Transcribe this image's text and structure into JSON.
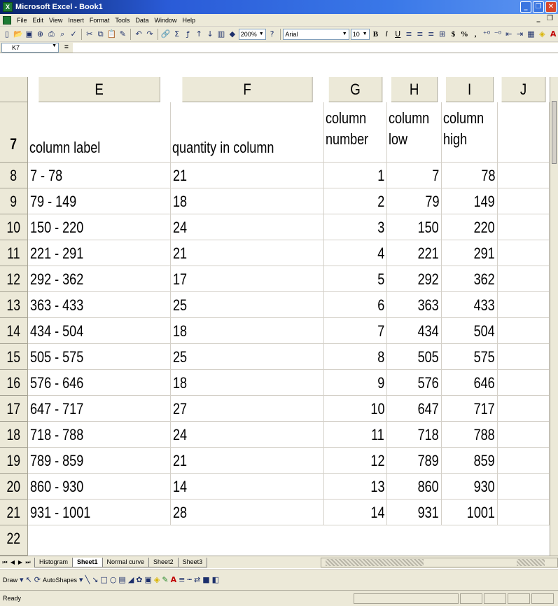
{
  "window": {
    "title": "Microsoft Excel - Book1"
  },
  "menu": [
    "File",
    "Edit",
    "View",
    "Insert",
    "Format",
    "Tools",
    "Data",
    "Window",
    "Help"
  ],
  "toolbar": {
    "zoom": "200%",
    "font": "Arial",
    "size": "10",
    "currency": "$",
    "percent": "%",
    "comma": ","
  },
  "formula_bar": {
    "name_box": "K7",
    "eq": "="
  },
  "columns": [
    "E",
    "F",
    "G",
    "H",
    "I",
    "J"
  ],
  "header_row": {
    "row": "7",
    "E": "column label",
    "F": "quantity in column",
    "G": [
      "column",
      "number"
    ],
    "H": [
      "column",
      "low"
    ],
    "I": [
      "column",
      "high"
    ]
  },
  "rows": [
    {
      "row": "8",
      "label": "7 - 78",
      "qty": "21",
      "num": "1",
      "low": "7",
      "high": "78"
    },
    {
      "row": "9",
      "label": "79 - 149",
      "qty": "18",
      "num": "2",
      "low": "79",
      "high": "149"
    },
    {
      "row": "10",
      "label": "150 - 220",
      "qty": "24",
      "num": "3",
      "low": "150",
      "high": "220"
    },
    {
      "row": "11",
      "label": "221 - 291",
      "qty": "21",
      "num": "4",
      "low": "221",
      "high": "291"
    },
    {
      "row": "12",
      "label": "292 - 362",
      "qty": "17",
      "num": "5",
      "low": "292",
      "high": "362"
    },
    {
      "row": "13",
      "label": "363 - 433",
      "qty": "25",
      "num": "6",
      "low": "363",
      "high": "433"
    },
    {
      "row": "14",
      "label": "434 - 504",
      "qty": "18",
      "num": "7",
      "low": "434",
      "high": "504"
    },
    {
      "row": "15",
      "label": "505 - 575",
      "qty": "25",
      "num": "8",
      "low": "505",
      "high": "575"
    },
    {
      "row": "16",
      "label": "576 - 646",
      "qty": "18",
      "num": "9",
      "low": "576",
      "high": "646"
    },
    {
      "row": "17",
      "label": "647 - 717",
      "qty": "27",
      "num": "10",
      "low": "647",
      "high": "717"
    },
    {
      "row": "18",
      "label": "718 - 788",
      "qty": "24",
      "num": "11",
      "low": "718",
      "high": "788"
    },
    {
      "row": "19",
      "label": "789 - 859",
      "qty": "21",
      "num": "12",
      "low": "789",
      "high": "859"
    },
    {
      "row": "20",
      "label": "860 - 930",
      "qty": "14",
      "num": "13",
      "low": "860",
      "high": "930"
    },
    {
      "row": "21",
      "label": "931 - 1001",
      "qty": "28",
      "num": "14",
      "low": "931",
      "high": "1001"
    }
  ],
  "last_row": "22",
  "sheet_tabs": [
    "Histogram",
    "Sheet1",
    "Normal curve",
    "Sheet2",
    "Sheet3"
  ],
  "active_tab": "Sheet1",
  "draw_toolbar": {
    "draw": "Draw",
    "autoshapes": "AutoShapes"
  },
  "status": "Ready"
}
